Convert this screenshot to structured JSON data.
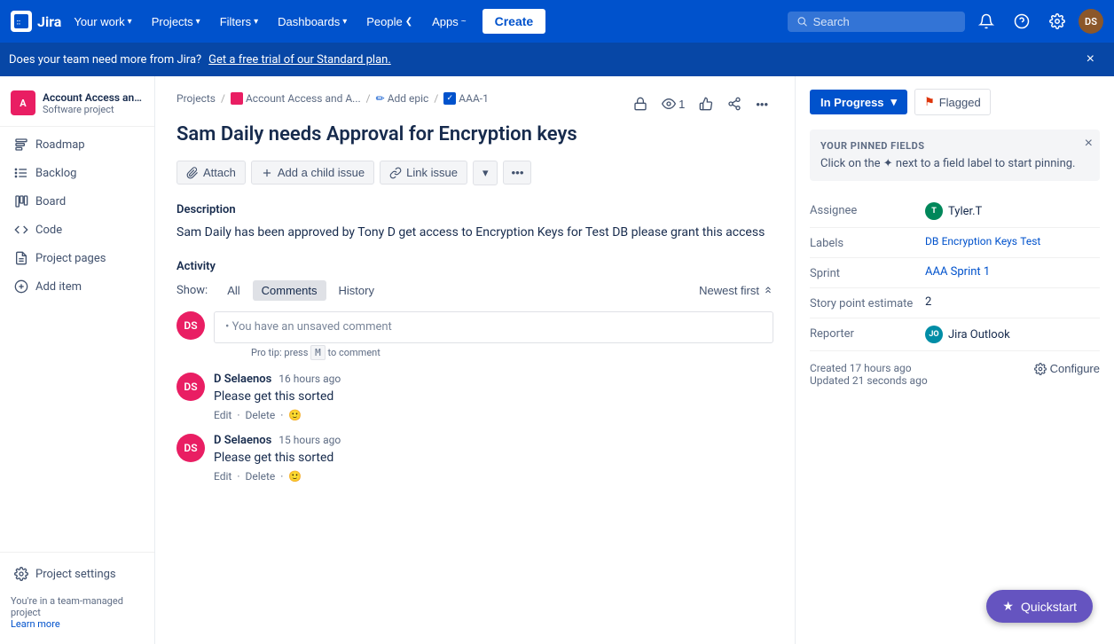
{
  "nav": {
    "logo_text": "Jira",
    "your_work": "Your work",
    "projects": "Projects",
    "filters": "Filters",
    "dashboards": "Dashboards",
    "people": "People",
    "apps": "Apps",
    "create": "Create",
    "search_placeholder": "Search"
  },
  "banner": {
    "text": "Does your team need more from Jira?",
    "link_text": "Get a free trial of our Standard plan."
  },
  "sidebar": {
    "project_name": "Account Access and Ap...",
    "project_type": "Software project",
    "items": [
      {
        "label": "Roadmap",
        "icon": "roadmap-icon"
      },
      {
        "label": "Backlog",
        "icon": "backlog-icon"
      },
      {
        "label": "Board",
        "icon": "board-icon"
      },
      {
        "label": "Code",
        "icon": "code-icon"
      },
      {
        "label": "Project pages",
        "icon": "pages-icon"
      },
      {
        "label": "Add item",
        "icon": "add-icon"
      },
      {
        "label": "Project settings",
        "icon": "settings-icon"
      }
    ],
    "footer_text": "You're in a team-managed project",
    "learn_more": "Learn more"
  },
  "breadcrumb": {
    "projects": "Projects",
    "project_name": "Account Access and A...",
    "add_epic": "Add epic",
    "issue_id": "AAA-1"
  },
  "issue": {
    "title": "Sam Daily needs Approval for Encryption keys",
    "actions": {
      "attach": "Attach",
      "add_child": "Add a child issue",
      "link": "Link issue"
    },
    "description_title": "Description",
    "description_text": "Sam Daily has been approved by Tony D  get access to Encryption Keys for Test DB please grant this access"
  },
  "activity": {
    "title": "Activity",
    "show_label": "Show:",
    "tabs": [
      "All",
      "Comments",
      "History"
    ],
    "active_tab": "Comments",
    "sort_label": "Newest first",
    "comment_placeholder": "• You have an unsaved comment",
    "pro_tip": "Pro tip: press",
    "pro_tip_key": "M",
    "pro_tip_suffix": "to comment",
    "comments": [
      {
        "author": "D Selaenos",
        "time": "16 hours ago",
        "text": "Please get this sorted",
        "initials": "DS"
      },
      {
        "author": "D Selaenos",
        "time": "15 hours ago",
        "text": "Please get this sorted",
        "initials": "DS"
      }
    ]
  },
  "right_panel": {
    "status": "In Progress",
    "flagged": "Flagged",
    "pinned_title": "YOUR PINNED FIELDS",
    "pinned_text": "Click on the",
    "pinned_text2": "next to a field label to start pinning.",
    "fields": {
      "assignee_label": "Assignee",
      "assignee_name": "Tyler.T",
      "assignee_initials": "T",
      "labels_label": "Labels",
      "labels": [
        "DB",
        "Encryption",
        "Keys",
        "Test"
      ],
      "sprint_label": "Sprint",
      "sprint_value": "AAA Sprint 1",
      "story_point_label": "Story point estimate",
      "story_point_value": "2",
      "reporter_label": "Reporter",
      "reporter_name": "Jira Outlook",
      "reporter_initials": "JO"
    },
    "created": "Created 17 hours ago",
    "updated": "Updated 21 seconds ago",
    "configure": "Configure"
  },
  "quickstart": {
    "label": "Quickstart"
  },
  "current_user_initials": "DS"
}
